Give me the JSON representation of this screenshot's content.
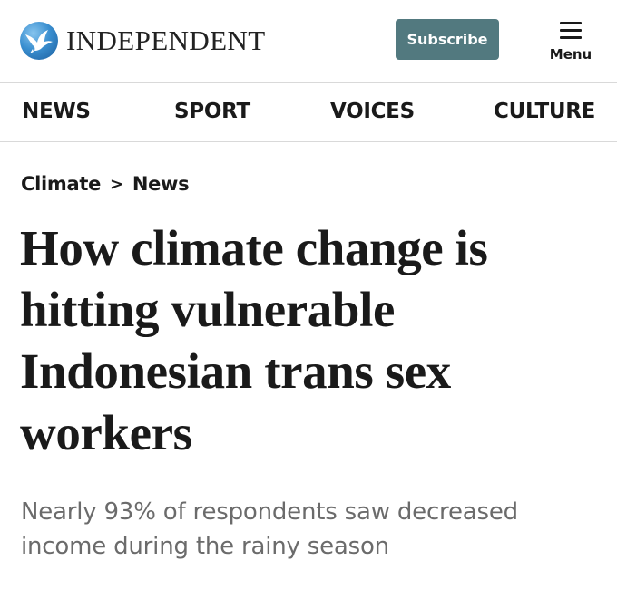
{
  "header": {
    "logo_text": "INDEPENDENT",
    "logo_icon": "eagle-icon",
    "subscribe_label": "Subscribe",
    "menu_label": "Menu",
    "menu_icon": "hamburger-icon",
    "colors": {
      "subscribe_bg": "#52797f",
      "logo_blue": "#3a8fd0"
    }
  },
  "nav": {
    "items": [
      {
        "label": "NEWS"
      },
      {
        "label": "SPORT"
      },
      {
        "label": "VOICES"
      },
      {
        "label": "CULTURE"
      }
    ]
  },
  "breadcrumb": {
    "section": "Climate",
    "separator": ">",
    "subsection": "News"
  },
  "article": {
    "headline": "How climate change is hitting vulnerable Indonesian trans sex workers",
    "standfirst": "Nearly 93% of respondents saw decreased income during the rainy season"
  }
}
